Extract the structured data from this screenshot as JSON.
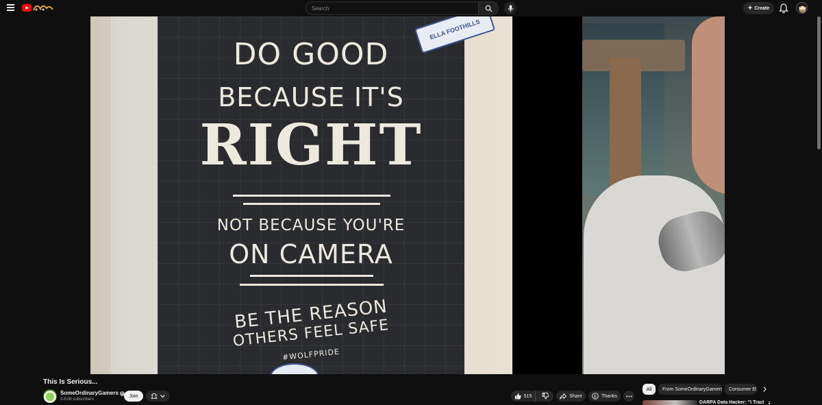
{
  "topbar": {
    "search_placeholder": "Search",
    "create_label": "Create"
  },
  "poster": {
    "stamp": "ELLA FOOTHILLS",
    "lines": [
      "DO GOOD",
      "BECAUSE IT'S",
      "RIGHT",
      "NOT BECAUSE YOU'RE",
      "ON CAMERA",
      "BE THE REASON",
      "OTHERS FEEL SAFE",
      "#WOLFPRIDE"
    ]
  },
  "video": {
    "title": "This Is Serious...",
    "channel_name": "SomeOrdinaryGamers",
    "subscribers": "3.81M subscribers",
    "join_label": "Join",
    "likes": "515",
    "share_label": "Share",
    "thanks_label": "Thanks"
  },
  "chips": [
    {
      "label": "All"
    },
    {
      "label": "From SomeOrdinaryGamers"
    },
    {
      "label": "Consumer Electronics"
    }
  ],
  "recommendations": [
    {
      "title": "DARPA Data Hacker: \"I Tracked"
    }
  ],
  "colors": {
    "background": "#0f0f0f",
    "surface": "#272727",
    "text": "#f1f1f1",
    "muted": "#aaaaaa",
    "brand_red": "#ff0000"
  }
}
